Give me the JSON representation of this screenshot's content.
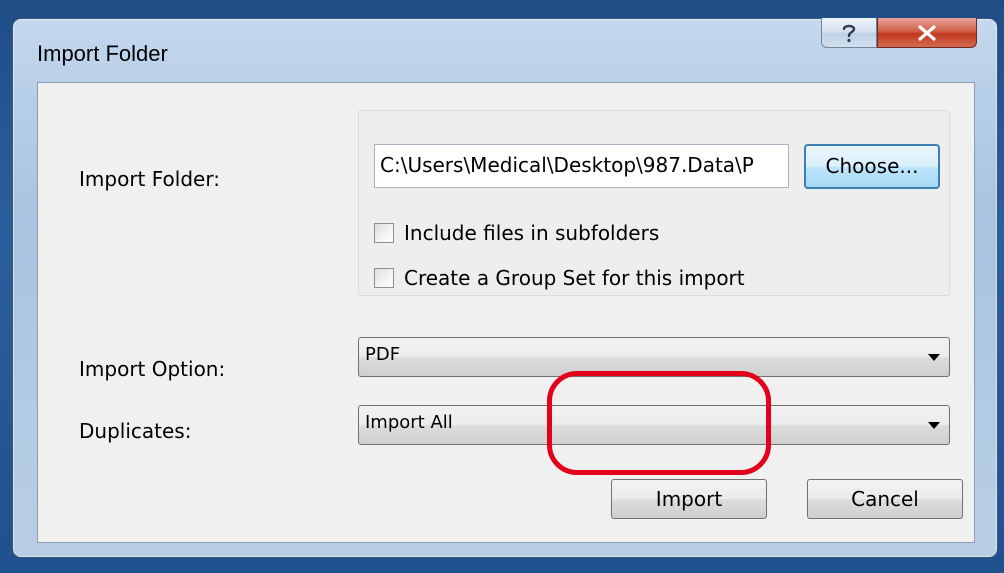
{
  "window": {
    "title": "Import Folder",
    "help_glyph": "?",
    "close_glyph": "x"
  },
  "form": {
    "folder_label": "Import Folder:",
    "folder_path": "C:\\Users\\Medical\\Desktop\\987.Data\\P",
    "choose_label": "Choose...",
    "include_subfolders": {
      "label": "Include files in subfolders",
      "checked": false
    },
    "create_group_set": {
      "label": "Create a Group Set for this import",
      "checked": false
    },
    "import_option_label": "Import Option:",
    "import_option_value": "PDF",
    "duplicates_label": "Duplicates:",
    "duplicates_value": "Import All"
  },
  "actions": {
    "import_label": "Import",
    "cancel_label": "Cancel"
  },
  "colors": {
    "highlight": "#e3001b",
    "close_button": "#c0391f",
    "focus_button_border": "#3c7fb1"
  },
  "icons": {
    "help": "help-icon",
    "close": "close-icon",
    "dropdown": "chevron-down-icon"
  }
}
